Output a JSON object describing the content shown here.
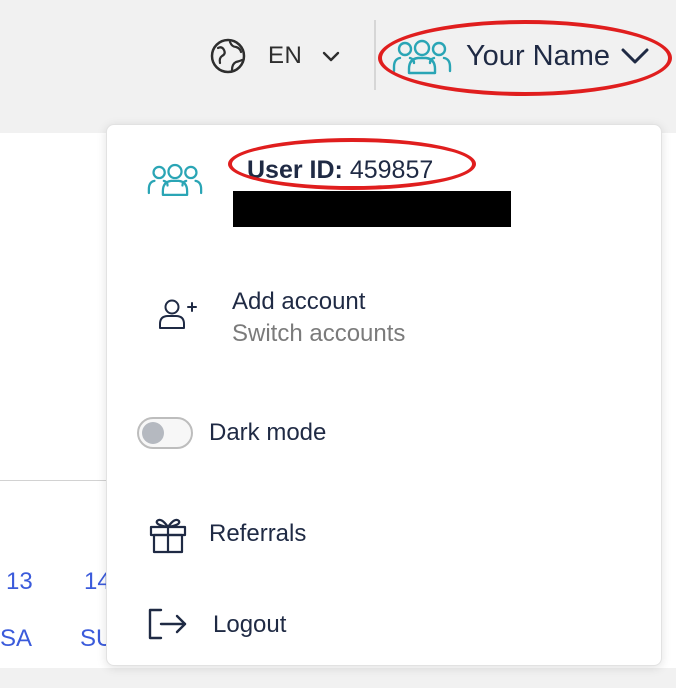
{
  "header": {
    "language": {
      "icon": "globe-icon",
      "code": "EN",
      "chevron_icon": "chevron-down-icon"
    },
    "user": {
      "icon": "users-icon",
      "name": "Your Name",
      "chevron_icon": "chevron-down-icon"
    }
  },
  "background": {
    "calendar": {
      "dates": [
        "13",
        "14"
      ],
      "days": [
        "SA",
        "SU"
      ]
    }
  },
  "dropdown": {
    "user_block": {
      "icon": "users-icon",
      "id_label": "User ID:",
      "id_value": "459857"
    },
    "add_account": {
      "icon": "add-user-icon",
      "title": "Add account",
      "subtitle": "Switch accounts"
    },
    "dark_mode": {
      "label": "Dark mode",
      "enabled": false
    },
    "referrals": {
      "icon": "gift-icon",
      "label": "Referrals"
    },
    "logout": {
      "icon": "logout-icon",
      "label": "Logout"
    }
  },
  "colors": {
    "accent": "#2aa5b5",
    "text": "#1f2a44",
    "muted": "#7b7b7b",
    "link": "#3b5bdb",
    "annotation": "#e01e1e",
    "topbar_bg": "#f1f1f1"
  }
}
